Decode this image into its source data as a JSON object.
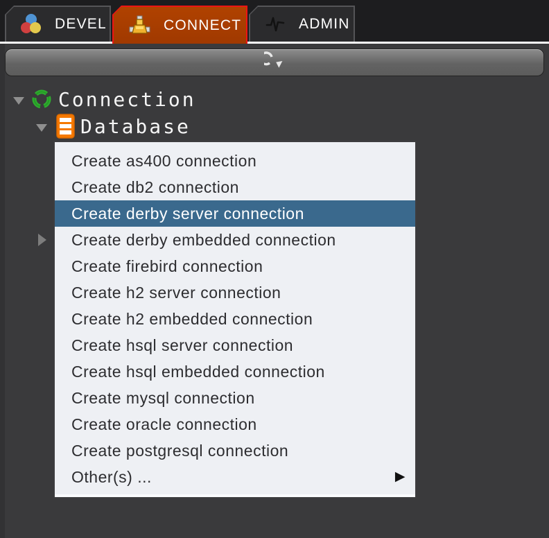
{
  "tabs": [
    {
      "label": "DEVEL",
      "icon": "palette-icon",
      "active": false
    },
    {
      "label": "CONNECT",
      "icon": "network-icon",
      "active": true
    },
    {
      "label": "ADMIN",
      "icon": "pulse-icon",
      "active": false
    }
  ],
  "toolbar": {
    "refresh_icon": "refresh-icon"
  },
  "tree": {
    "root_label": "Connection",
    "child_label": "Database"
  },
  "menu": {
    "selected_index": 2,
    "items": [
      {
        "label": "Create as400 connection"
      },
      {
        "label": "Create db2 connection"
      },
      {
        "label": "Create derby server connection"
      },
      {
        "label": "Create derby embedded connection"
      },
      {
        "label": "Create firebird connection"
      },
      {
        "label": "Create h2 server connection"
      },
      {
        "label": "Create h2 embedded connection"
      },
      {
        "label": "Create hsql server connection"
      },
      {
        "label": "Create hsql embedded connection"
      },
      {
        "label": "Create mysql connection"
      },
      {
        "label": "Create oracle connection"
      },
      {
        "label": "Create postgresql connection"
      },
      {
        "label": "Other(s) ..."
      }
    ],
    "submenu_arrow": "▶"
  },
  "colors": {
    "panel_bg": "#3a3a3c",
    "tabbar_bg": "#1d1d1f",
    "inactive_tab": "#2b2b2d",
    "active_tab_fill": "#a83d00",
    "active_tab_border": "#ee1414",
    "tab_underline": "#ffffff",
    "menu_bg": "#eef0f4",
    "menu_selected": "#3a698d",
    "tree_icon_green": "#2fae2f",
    "tree_icon_orange": "#f57900"
  }
}
